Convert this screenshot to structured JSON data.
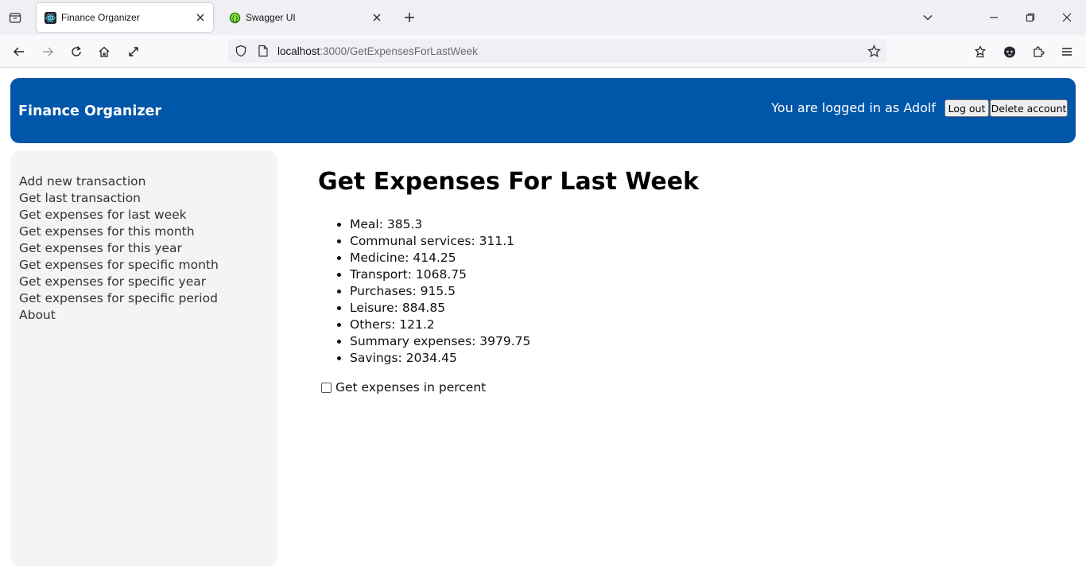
{
  "browser": {
    "tabs": [
      {
        "title": "Finance Organizer",
        "active": true,
        "favicon": "react-icon"
      },
      {
        "title": "Swagger UI",
        "active": false,
        "favicon": "swagger-icon"
      }
    ],
    "url": {
      "host": "localhost",
      "path": ":3000/GetExpensesForLastWeek"
    }
  },
  "header": {
    "app_title": "Finance Organizer",
    "logged_in_text": "You are logged in as Adolf",
    "logout_label": "Log out",
    "delete_account_label": "Delete account",
    "color": "#0056a9"
  },
  "sidebar": {
    "items": [
      {
        "label": "Add new transaction"
      },
      {
        "label": "Get last transaction"
      },
      {
        "label": "Get expenses for last week"
      },
      {
        "label": "Get expenses for this month"
      },
      {
        "label": "Get expenses for this year"
      },
      {
        "label": "Get expenses for specific month"
      },
      {
        "label": "Get expenses for specific year"
      },
      {
        "label": "Get expenses for specific period"
      },
      {
        "label": "About"
      }
    ]
  },
  "main": {
    "title": "Get Expenses For Last Week",
    "expenses": [
      {
        "text": "Meal: 385.3"
      },
      {
        "text": "Communal services: 311.1"
      },
      {
        "text": "Medicine: 414.25"
      },
      {
        "text": "Transport: 1068.75"
      },
      {
        "text": "Purchases: 915.5"
      },
      {
        "text": "Leisure: 884.85"
      },
      {
        "text": "Others: 121.2"
      },
      {
        "text": "Summary expenses: 3979.75"
      },
      {
        "text": "Savings: 2034.45"
      }
    ],
    "percent_checkbox": {
      "label": "Get expenses in percent",
      "checked": false
    }
  }
}
